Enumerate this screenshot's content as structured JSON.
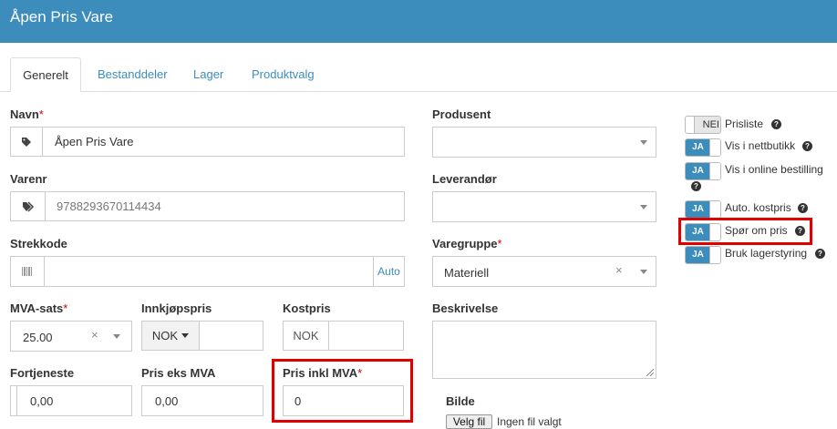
{
  "header": {
    "title": "Åpen Pris Vare"
  },
  "tabs": [
    {
      "label": "Generelt"
    },
    {
      "label": "Bestanddeler"
    },
    {
      "label": "Lager"
    },
    {
      "label": "Produktvalg"
    }
  ],
  "fields": {
    "navn": {
      "label": "Navn",
      "required": "*",
      "value": "Åpen Pris Vare",
      "icon": "tag-icon"
    },
    "varenr": {
      "label": "Varenr",
      "required": "",
      "value": "9788293670114434",
      "icon": "tags-icon"
    },
    "strekkode": {
      "label": "Strekkode",
      "value": "",
      "addon": "Auto",
      "icon": "barcode-icon"
    },
    "mva": {
      "label": "MVA-sats",
      "required": "*",
      "value": "25.00",
      "clear": "×"
    },
    "innkjopspris": {
      "label": "Innkjøpspris",
      "currency": "NOK",
      "value": ""
    },
    "kostpris": {
      "label": "Kostpris",
      "currency": "NOK",
      "value": ""
    },
    "fortjeneste": {
      "label": "Fortjeneste",
      "value": "0,00"
    },
    "pris_eks": {
      "label": "Pris eks MVA",
      "value": "0,00"
    },
    "pris_inkl": {
      "label": "Pris inkl MVA",
      "required": "*",
      "value": "0"
    },
    "produsent": {
      "label": "Produsent",
      "value": ""
    },
    "leverandor": {
      "label": "Leverandør",
      "value": ""
    },
    "varegruppe": {
      "label": "Varegruppe",
      "required": "*",
      "value": "Materiell",
      "clear": "×"
    },
    "beskrivelse": {
      "label": "Beskrivelse",
      "value": ""
    },
    "bilde": {
      "label": "Bilde",
      "button": "Velg fil",
      "status": "Ingen fil valgt"
    }
  },
  "toggles": [
    {
      "state": "NEI",
      "label": "Prisliste",
      "help": "?"
    },
    {
      "state": "JA",
      "label": "Vis i nettbutikk",
      "help": "?"
    },
    {
      "state": "JA",
      "label": "Vis i online bestilling",
      "help": "?"
    },
    {
      "state": "JA",
      "label": "Auto. kostpris",
      "help": "?"
    },
    {
      "state": "JA",
      "label": "Spør om pris",
      "help": "?"
    },
    {
      "state": "JA",
      "label": "Bruk lagerstyring",
      "help": "?"
    }
  ],
  "colors": {
    "header": "#3c8dbc",
    "toggle_on": "#3c8dbc",
    "highlight": "#e00000"
  }
}
